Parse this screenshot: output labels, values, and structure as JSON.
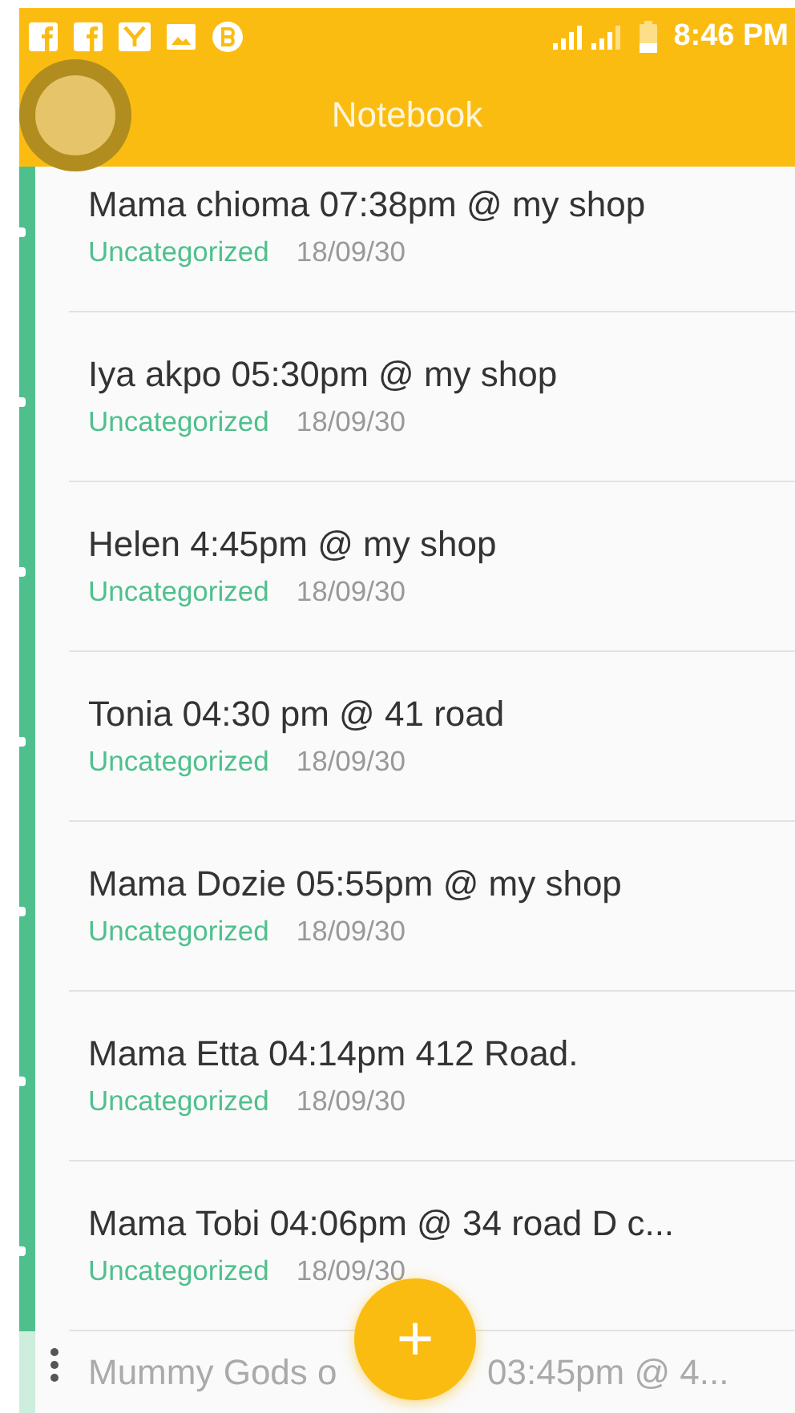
{
  "status_bar": {
    "time": "8:46 PM"
  },
  "app_bar": {
    "title": "Notebook"
  },
  "notes": [
    {
      "title": "Mama chioma 07:38pm @ my shop",
      "category": "Uncategorized",
      "date": "18/09/30"
    },
    {
      "title": "Iya akpo 05:30pm @ my shop",
      "category": "Uncategorized",
      "date": "18/09/30"
    },
    {
      "title": "Helen 4:45pm @ my shop",
      "category": "Uncategorized",
      "date": "18/09/30"
    },
    {
      "title": "Tonia 04:30 pm @ 41 road",
      "category": "Uncategorized",
      "date": "18/09/30"
    },
    {
      "title": "Mama Dozie 05:55pm @ my shop",
      "category": "Uncategorized",
      "date": "18/09/30"
    },
    {
      "title": "Mama Etta 04:14pm 412 Road.",
      "category": "Uncategorized",
      "date": "18/09/30"
    },
    {
      "title": "Mama Tobi 04:06pm @ 34 road D c...",
      "category": "Uncategorized",
      "date": "18/09/30"
    }
  ],
  "faded_note": {
    "title_start": "Mummy Gods o",
    "title_end": "03:45pm @ 4..."
  },
  "fab": {
    "label": "+"
  }
}
